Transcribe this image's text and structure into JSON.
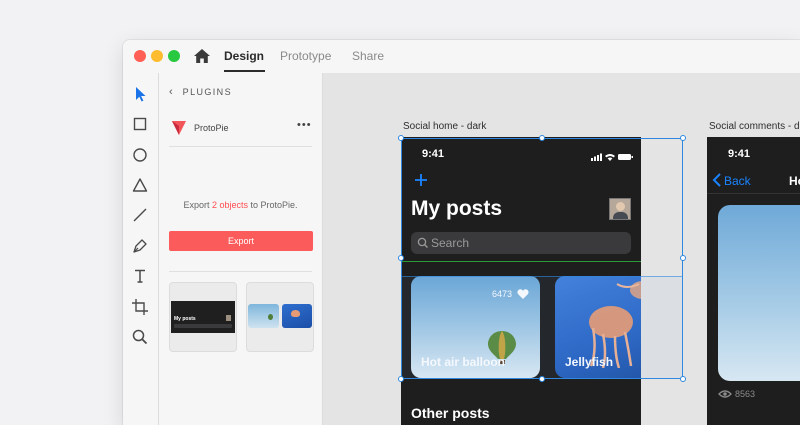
{
  "window": {
    "tabs": [
      {
        "label": "Design",
        "active": true
      },
      {
        "label": "Prototype",
        "active": false
      },
      {
        "label": "Share",
        "active": false
      }
    ],
    "traffic_lights": [
      "#ff5f57",
      "#febc2e",
      "#28c840"
    ]
  },
  "toolbar": {
    "tools": [
      "select-tool",
      "rectangle-tool",
      "ellipse-tool",
      "triangle-tool",
      "line-tool",
      "pen-tool",
      "text-tool",
      "artboard-tool",
      "zoom-tool"
    ],
    "active_tool": "select-tool",
    "accent_color": "#1a73e8"
  },
  "panel": {
    "header": "PLUGINS",
    "plugin_name": "ProtoPie",
    "export_before": "Export ",
    "export_count": "2 objects",
    "export_after": " to ProtoPie.",
    "export_button": "Export",
    "thumb_title": "My posts"
  },
  "canvas": {
    "artboard1_label": "Social home - dark",
    "artboard2_label": "Social comments - d",
    "phone1": {
      "time": "9:41",
      "title": "My posts",
      "search_placeholder": "Search",
      "card1_label": "Hot air balloon",
      "card1_count": "6473",
      "card2_label": "Jellyfish",
      "section": "Other posts"
    },
    "phone2": {
      "time": "9:41",
      "back": "Back",
      "title_partial": "Ho",
      "views": "8563"
    }
  }
}
